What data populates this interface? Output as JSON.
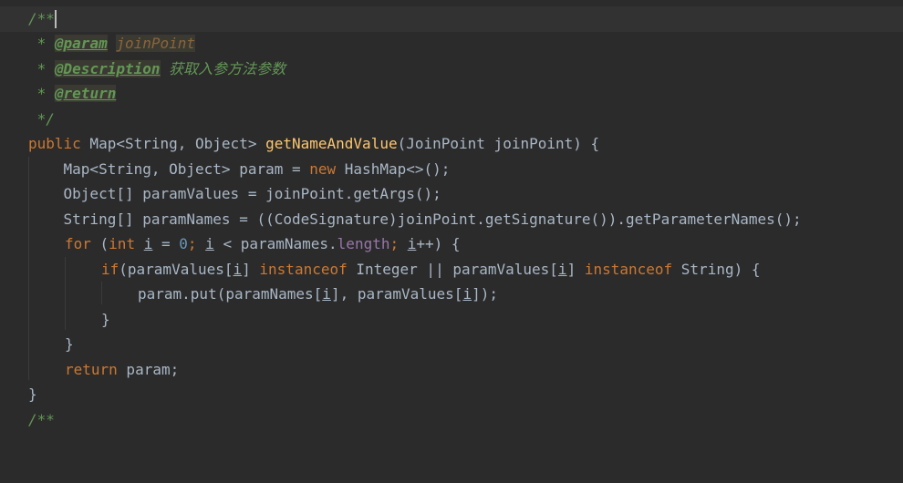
{
  "editor": {
    "language": "Java",
    "colors": {
      "background": "#2b2b2b",
      "current_line": "#323232",
      "doc_comment": "#629755",
      "keyword": "#cc7832",
      "method_name": "#ffc66d",
      "number": "#6897bb",
      "field": "#9876aa",
      "text": "#a9b7c6"
    },
    "lines": [
      {
        "prefix": "/**"
      },
      {
        "star": " * ",
        "tag": "@param",
        "param": "joinPoint"
      },
      {
        "star": " * ",
        "tag": "@Description",
        "desc": "获取入参方法参数"
      },
      {
        "star": " * ",
        "tag": "@return"
      },
      {
        "text": " */"
      },
      {
        "kw": "public",
        "type": " Map<String, Object> ",
        "method": "getNameAndValue",
        "rest": "(JoinPoint joinPoint) {"
      },
      {
        "pre": "    Map<String, Object> param = ",
        "kw": "new",
        "post": " HashMap<>();"
      },
      {
        "text": "    Object[] paramValues = joinPoint.getArgs();"
      },
      {
        "text": "    String[] paramNames = ((CodeSignature)joinPoint.getSignature()).getParameterNames();"
      },
      {
        "kw": "for",
        "a": " (",
        "kw2": "int",
        "b": " ",
        "var": "i",
        "c": " = ",
        "num": "0",
        "d": "; ",
        "var2": "i",
        "e": " < paramNames.",
        "field": "length",
        "f": "; ",
        "var3": "i",
        "g": "++) {"
      },
      {
        "kw": "if",
        "a": "(paramValues[",
        "var": "i",
        "b": "] ",
        "kw2": "instanceof",
        "c": " Integer || paramValues[",
        "var2": "i",
        "d": "] ",
        "kw3": "instanceof",
        "e": " String) {"
      },
      {
        "a": "param.put(paramNames[",
        "var": "i",
        "b": "], paramValues[",
        "var2": "i",
        "c": "]);"
      },
      {
        "text": "}"
      },
      {
        "text": "}"
      },
      {
        "kw": "return",
        "rest": " param;"
      },
      {
        "text": "}"
      },
      {
        "prefix": "/**"
      }
    ]
  }
}
